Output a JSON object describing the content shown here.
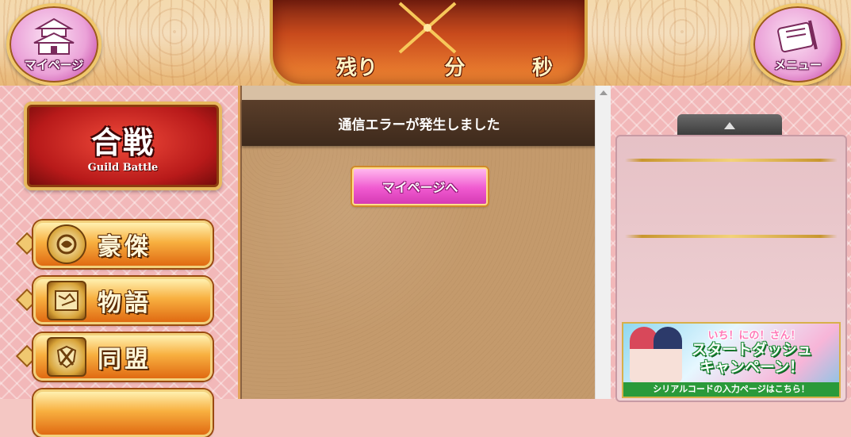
{
  "header": {
    "left_button_label": "マイページ",
    "right_button_label": "メニュー",
    "timer": {
      "remain_label": "残り",
      "minute_label": "分",
      "second_label": "秒"
    }
  },
  "left_sidebar": {
    "guild": {
      "title": "合戦",
      "subtitle": "Guild Battle"
    },
    "items": [
      {
        "label": "豪傑",
        "icon": "tiger-emblem-icon"
      },
      {
        "label": "物語",
        "icon": "map-scroll-icon"
      },
      {
        "label": "同盟",
        "icon": "crossed-swords-shield-icon"
      }
    ]
  },
  "main": {
    "error_message": "通信エラーが発生しました",
    "mypage_button": "マイページへ"
  },
  "right_sidebar": {
    "banner": {
      "top_text": "いち！にの！さん！",
      "headline_1": "スタートダッシュ",
      "headline_2": "キャンペーン！",
      "footer": "シリアルコードの入力ページはこちら！"
    }
  },
  "colors": {
    "accent_pink": "#f05ad0",
    "gold_border": "#e7b95e",
    "panel_pink": "#f2b8b9",
    "error_bar": "#4a3222"
  }
}
